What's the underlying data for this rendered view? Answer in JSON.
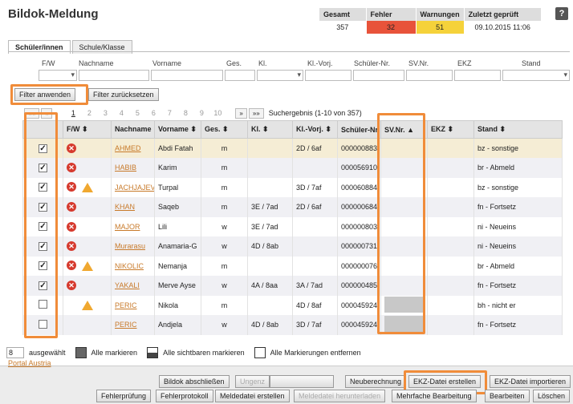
{
  "title": "Bildok-Meldung",
  "stats": {
    "headers": [
      "Gesamt",
      "Fehler",
      "Warnungen",
      "Zuletzt geprüft"
    ],
    "values": [
      "357",
      "32",
      "51",
      "09.10.2015 11:06"
    ],
    "colors": {
      "fehler": "#e8533a",
      "warnungen": "#f5d23a"
    }
  },
  "tabs": [
    "Schüler/innen",
    "Schule/Klasse"
  ],
  "filter_labels": [
    "F/W",
    "Nachname",
    "Vorname",
    "Ges.",
    "Kl.",
    "Kl.-Vorj.",
    "Schüler-Nr.",
    "SV.Nr.",
    "EKZ",
    "Stand"
  ],
  "filter_buttons": {
    "apply": "Filter anwenden",
    "reset": "Filter zurücksetzen"
  },
  "pager": {
    "first": "««",
    "prev": "«",
    "pages": [
      "1",
      "2",
      "3",
      "4",
      "5",
      "6",
      "7",
      "8",
      "9",
      "10"
    ],
    "next": "»",
    "last": "»»",
    "result": "Suchergebnis (1-10 von 357)"
  },
  "columns": [
    "",
    "F/W ⬍",
    "Nachname ⬍",
    "Vorname ⬍",
    "Ges. ⬍",
    "Kl. ⬍",
    "Kl.-Vorj. ⬍",
    "Schüler-Nr.",
    "SV.Nr. ▲",
    "EKZ ⬍",
    "Stand ⬍"
  ],
  "rows": [
    {
      "checked": true,
      "err": true,
      "warn": false,
      "nachname": "AHMED",
      "vorname": "Abdi Fatah",
      "ges": "m",
      "kl": "",
      "klvorj": "2D / 6af",
      "nr": "000000883",
      "stand": "bz - sonstige"
    },
    {
      "checked": true,
      "err": true,
      "warn": false,
      "nachname": "HABIB",
      "vorname": "Karim",
      "ges": "m",
      "kl": "",
      "klvorj": "",
      "nr": "000056910",
      "stand": "br - Abmeld"
    },
    {
      "checked": true,
      "err": true,
      "warn": true,
      "nachname": "JACHJAJEV",
      "vorname": "Turpal",
      "ges": "m",
      "kl": "",
      "klvorj": "3D / 7af",
      "nr": "000060884",
      "stand": "bz - sonstige"
    },
    {
      "checked": true,
      "err": true,
      "warn": false,
      "nachname": "KHAN",
      "vorname": "Saqeb",
      "ges": "m",
      "kl": "3E / 7ad",
      "klvorj": "2D / 6af",
      "nr": "000000684",
      "stand": "fn - Fortsetz"
    },
    {
      "checked": true,
      "err": true,
      "warn": false,
      "nachname": "MAJOR",
      "vorname": "Lili",
      "ges": "w",
      "kl": "3E / 7ad",
      "klvorj": "",
      "nr": "000000803",
      "stand": "ni - Neueins"
    },
    {
      "checked": true,
      "err": true,
      "warn": false,
      "nachname": "Murarasu",
      "vorname": "Anamaria-G",
      "ges": "w",
      "kl": "4D / 8ab",
      "klvorj": "",
      "nr": "000000731",
      "stand": "ni - Neueins"
    },
    {
      "checked": true,
      "err": true,
      "warn": true,
      "nachname": "NIKOLIC",
      "vorname": "Nemanja",
      "ges": "m",
      "kl": "",
      "klvorj": "",
      "nr": "000000076",
      "stand": "br - Abmeld"
    },
    {
      "checked": true,
      "err": true,
      "warn": false,
      "nachname": "YAKALI",
      "vorname": "Merve Ayse",
      "ges": "w",
      "kl": "4A / 8aa",
      "klvorj": "3A / 7ad",
      "nr": "000000485",
      "stand": "fn - Fortsetz"
    },
    {
      "checked": false,
      "err": false,
      "warn": true,
      "nachname": "PERIC",
      "vorname": "Nikola",
      "ges": "m",
      "kl": "",
      "klvorj": "4D / 8af",
      "nr": "000045924",
      "stand": "bh - nicht er"
    },
    {
      "checked": false,
      "err": false,
      "warn": false,
      "nachname": "PERIC",
      "vorname": "Andjela",
      "ges": "w",
      "kl": "4D / 8ab",
      "klvorj": "3D / 7af",
      "nr": "000045924",
      "stand": "fn - Fortsetz"
    }
  ],
  "selection": {
    "count": "8",
    "label": "ausgewählt",
    "mark_all": "Alle markieren",
    "mark_visible": "Alle sichtbaren markieren",
    "unmark": "Alle Markierungen entfernen"
  },
  "portal": "Portal Austria",
  "buttons_row1": [
    "Bildok abschließen",
    "Ungenz",
    "",
    "Neuberechnung",
    "EKZ-Datei erstellen",
    "EKZ-Datei importieren"
  ],
  "buttons_row2": [
    "Fehlerprüfung",
    "Fehlerprotokoll",
    "Meldedatei erstellen",
    "Meldedatei herunterladen",
    "Mehrfache Bearbeitung",
    "Bearbeiten",
    "Löschen"
  ],
  "highlight_color": "#f08c3a"
}
